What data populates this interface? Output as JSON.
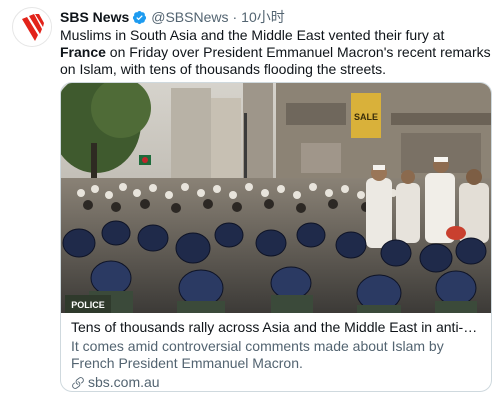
{
  "tweet": {
    "display_name": "SBS News",
    "handle": "@SBSNews",
    "separator": "·",
    "time": "10小时",
    "text_before": "Muslims in South Asia and the Middle East vented their fury at ",
    "text_bold": "France",
    "text_after": " on Friday over President Emmanuel Macron's recent remarks on Islam, with tens of thousands flooding the streets."
  },
  "card": {
    "title": "Tens of thousands rally across Asia and the Middle East in anti-Fr…",
    "description": "It comes amid controversial comments made about Islam by French President Emmanuel Macron.",
    "domain": "sbs.com.au",
    "image_signs": {
      "sale": "SALE",
      "police": "POLICE"
    }
  },
  "colors": {
    "brand_red": "#e2231a",
    "verified_blue": "#1d9bf0",
    "text_primary": "#0f1419",
    "text_secondary": "#536471",
    "border": "#cfd9de"
  },
  "icons": {
    "avatar": "sbs-logo-icon",
    "verified": "verified-badge-icon",
    "link": "link-icon"
  }
}
